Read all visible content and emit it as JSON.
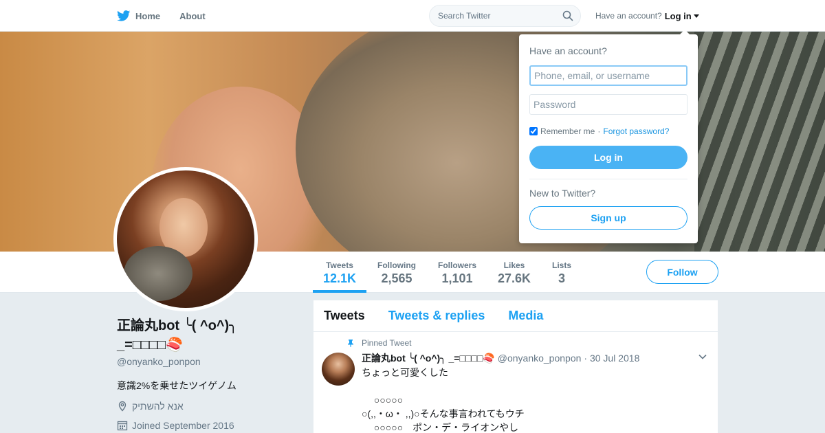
{
  "nav": {
    "home_label": "Home",
    "about_label": "About",
    "search_placeholder": "Search Twitter",
    "account_prompt": "Have an account?",
    "login_label": "Log in",
    "brand_color": "#1da1f2"
  },
  "profile": {
    "name": "正論丸bot ╰( ^o^)╮ _=□□□□🍣",
    "handle": "@onyanko_ponpon",
    "bio": "意識2%を乗せたツイゲノム",
    "location": "אנא להשתיק",
    "joined": "Joined September 2016"
  },
  "stats": [
    {
      "label": "Tweets",
      "value": "12.1K",
      "active": true
    },
    {
      "label": "Following",
      "value": "2,565"
    },
    {
      "label": "Followers",
      "value": "1,101"
    },
    {
      "label": "Likes",
      "value": "27.6K"
    },
    {
      "label": "Lists",
      "value": "3"
    }
  ],
  "follow_label": "Follow",
  "timeline": {
    "tabs": [
      "Tweets",
      "Tweets & replies",
      "Media"
    ],
    "active_tab": "Tweets",
    "tweet": {
      "pinned_label": "Pinned Tweet",
      "author_name": "正論丸bot ╰( ^o^)╮ _=□□□□🍣",
      "author_handle": "@onyanko_ponpon",
      "date": "· 30 Jul 2018",
      "body": "ちょっと可愛くした\n\n　 ○○○○○\n○(,,・ω・ ,,)○そんな事言われてもウチ\n　 ○○○○○　ポン・デ・ライオンやし"
    }
  },
  "login_dropdown": {
    "title": "Have an account?",
    "username_placeholder": "Phone, email, or username",
    "password_placeholder": "Password",
    "remember_label": "Remember me",
    "separator": "·",
    "forgot_label": "Forgot password?",
    "login_button": "Log in",
    "new_prompt": "New to Twitter?",
    "signup_button": "Sign up",
    "remember_checked": true
  },
  "icons": [
    "twitter-bird-icon",
    "search-icon",
    "caret-down-icon",
    "location-icon",
    "calendar-icon",
    "pin-icon",
    "chevron-down-icon"
  ]
}
